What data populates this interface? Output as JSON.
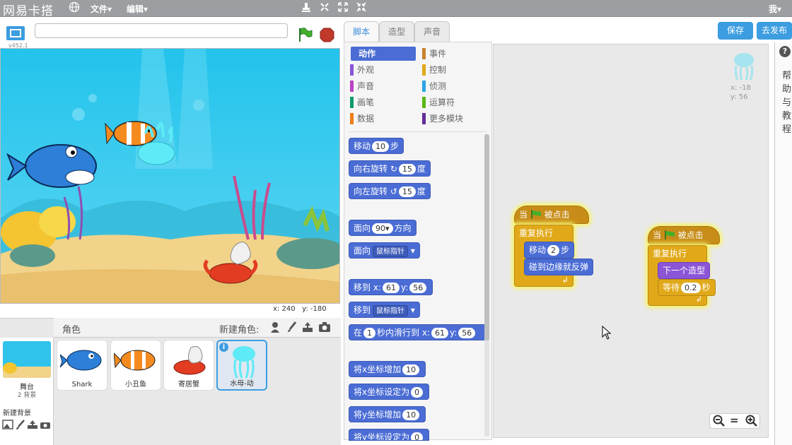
{
  "topbar": {
    "brand": "网易卡搭",
    "menu_file": "文件▾",
    "menu_edit": "编辑▾",
    "user": "我▾"
  },
  "stage": {
    "version": "v452.1",
    "coords_x_label": "x:",
    "coords_x": "240",
    "coords_y_label": "y:",
    "coords_y": "-180"
  },
  "sprite_pane": {
    "header": "角色",
    "new_sprite": "新建角色:",
    "stage_name": "舞台",
    "stage_backdrops": "2 背景",
    "new_backdrop": "新建背景",
    "sprites": [
      {
        "name": "Shark"
      },
      {
        "name": "小丑鱼"
      },
      {
        "name": "寄居蟹"
      },
      {
        "name": "水母-动"
      }
    ]
  },
  "tabs": [
    "脚本",
    "造型",
    "声音"
  ],
  "categories": [
    {
      "label": "动作",
      "color": "#4a6cd4"
    },
    {
      "label": "事件",
      "color": "#c88330"
    },
    {
      "label": "外观",
      "color": "#8a55d7"
    },
    {
      "label": "控制",
      "color": "#e1a91a"
    },
    {
      "label": "声音",
      "color": "#bb42c3"
    },
    {
      "label": "侦测",
      "color": "#2ca5e2"
    },
    {
      "label": "画笔",
      "color": "#0e9a6c"
    },
    {
      "label": "运算符",
      "color": "#5cb712"
    },
    {
      "label": "数据",
      "color": "#ee7d16"
    },
    {
      "label": "更多模块",
      "color": "#632d99"
    }
  ],
  "palette": {
    "move_a": "移动",
    "move_n": "10",
    "move_b": "步",
    "turn_r_a": "向右旋转",
    "turn_r_n": "15",
    "turn_r_b": "度",
    "turn_l_a": "向左旋转",
    "turn_l_n": "15",
    "turn_l_b": "度",
    "point_dir_a": "面向",
    "point_dir_n": "90▾",
    "point_dir_b": "方向",
    "point_to_a": "面向",
    "point_to_d": "鼠标指针",
    "goto_xy_a": "移到",
    "goto_xy_x": "x:",
    "goto_xy_xn": "61",
    "goto_xy_y": "y:",
    "goto_xy_yn": "56",
    "goto_a": "移到",
    "goto_d": "鼠标指针",
    "glide_a": "在",
    "glide_n": "1",
    "glide_b": "秒内滑行到",
    "glide_x": "x:",
    "glide_xn": "61",
    "glide_y": "y:",
    "glide_yn": "56",
    "change_x_a": "将x坐标增加",
    "change_x_n": "10",
    "set_x_a": "将x坐标设定为",
    "set_x_n": "0",
    "change_y_a": "将y坐标增加",
    "change_y_n": "10",
    "set_y_a": "将y坐标设定为",
    "set_y_n": "0"
  },
  "buttons": {
    "save": "保存",
    "share": "去发布"
  },
  "help": {
    "label": "帮助与教程"
  },
  "script_sprite": {
    "x_label": "x:",
    "x": "-18",
    "y_label": "y:",
    "y": "56"
  },
  "script1": {
    "hat_a": "当",
    "hat_b": "被点击",
    "forever": "重复执行",
    "move_a": "移动",
    "move_n": "2",
    "move_b": "步",
    "bounce": "碰到边缘就反弹"
  },
  "script2": {
    "hat_a": "当",
    "hat_b": "被点击",
    "forever": "重复执行",
    "next_costume": "下一个造型",
    "wait_a": "等待",
    "wait_n": "0.2",
    "wait_b": "秒"
  },
  "zoom": {
    "minus": "−",
    "reset": "=",
    "plus": "+"
  }
}
